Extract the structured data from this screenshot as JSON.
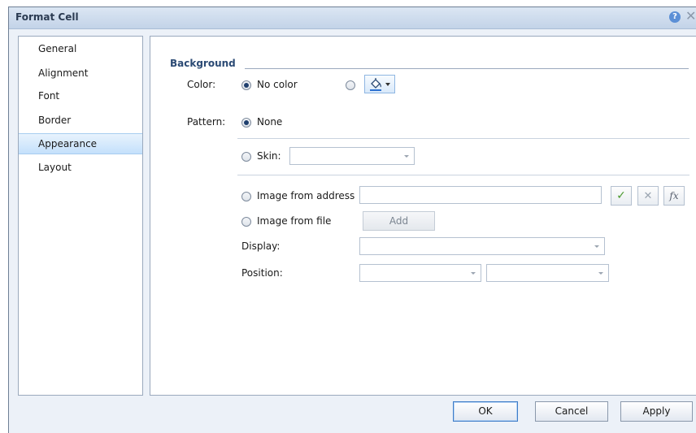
{
  "dialog": {
    "title": "Format Cell"
  },
  "nav": {
    "items": [
      {
        "label": "General"
      },
      {
        "label": "Alignment"
      },
      {
        "label": "Font"
      },
      {
        "label": "Border"
      },
      {
        "label": "Appearance",
        "selected": true
      },
      {
        "label": "Layout"
      }
    ]
  },
  "background": {
    "heading": "Background",
    "color_label": "Color:",
    "no_color_option": "No color",
    "color_option_selected": "No color",
    "pattern_label": "Pattern:",
    "pattern_none_option": "None",
    "pattern_selected": "None",
    "skin_label": "Skin:",
    "skin_value": "",
    "image_from_address_label": "Image from address",
    "image_address_value": "",
    "image_from_file_label": "Image from file",
    "add_button": "Add",
    "display_label": "Display:",
    "display_value": "",
    "position_label": "Position:",
    "position_value_1": "",
    "position_value_2": ""
  },
  "icons": {
    "help": "help-icon",
    "close": "close-icon",
    "paint_bucket": "paint-bucket-icon",
    "confirm": "check-icon",
    "cancel": "x-icon",
    "formula": "fx-icon"
  },
  "footer": {
    "ok_label": "OK",
    "cancel_label": "Cancel",
    "apply_label": "Apply"
  },
  "colors": {
    "accent": "#3e7cc8",
    "selection": "#c4e0fb",
    "heading": "#2b4a74"
  }
}
